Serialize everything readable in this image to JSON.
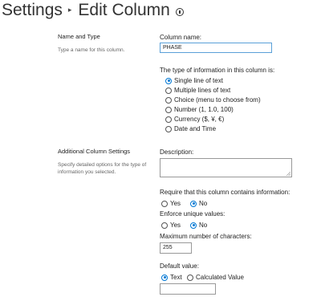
{
  "header": {
    "breadcrumb_parent": "Settings",
    "separator": "▸",
    "title": "Edit Column",
    "info_icon": "info-circle-icon"
  },
  "sections": {
    "name_type": {
      "title": "Name and Type",
      "description": "Type a name for this column."
    },
    "additional": {
      "title": "Additional Column Settings",
      "description": "Specify detailed options for the type of information you selected."
    }
  },
  "column_name": {
    "label": "Column name:",
    "value": "PHASE"
  },
  "type_info": {
    "label": "The type of information in this column is:",
    "options": [
      "Single line of text",
      "Multiple lines of text",
      "Choice (menu to choose from)",
      "Number (1, 1.0, 100)",
      "Currency ($, ¥, €)",
      "Date and Time"
    ],
    "selected": "Single line of text"
  },
  "description": {
    "label": "Description:",
    "value": ""
  },
  "require": {
    "label": "Require that this column contains information:",
    "yes": "Yes",
    "no": "No",
    "selected": "No"
  },
  "unique": {
    "label": "Enforce unique values:",
    "yes": "Yes",
    "no": "No",
    "selected": "No"
  },
  "max_chars": {
    "label": "Maximum number of characters:",
    "value": "255"
  },
  "default_value": {
    "label": "Default value:",
    "text_option": "Text",
    "calculated_option": "Calculated Value",
    "selected": "Text",
    "value": ""
  },
  "colors": {
    "accent": "#0078d4",
    "focus_border": "#5aa0d8",
    "border": "#999999",
    "muted_text": "#666666"
  }
}
